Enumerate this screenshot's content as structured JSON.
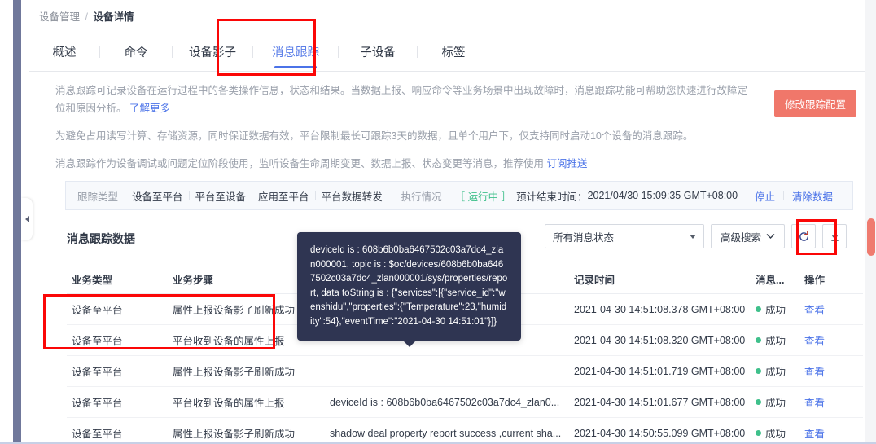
{
  "breadcrumb": {
    "parent": "设备管理",
    "separator": "/",
    "current": "设备详情"
  },
  "tabs": [
    {
      "label": "概述",
      "active": false
    },
    {
      "label": "命令",
      "active": false
    },
    {
      "label": "设备影子",
      "active": false
    },
    {
      "label": "消息跟踪",
      "active": true
    },
    {
      "label": "子设备",
      "active": false
    },
    {
      "label": "标签",
      "active": false
    }
  ],
  "description": {
    "line1_a": "消息跟踪可记录设备在运行过程中的各类操作信息，状态和结果。当数据上报、响应命令等业务场景中出现故障时，消息跟踪功能可帮助您快速进行故障定位和原因分析。",
    "line1_link": "了解更多",
    "line2": "为避免占用读写计算、存储资源，同时保证数据有效，平台限制最长可跟踪3天的数据，且单个用户下，仅支持同时启动10个设备的消息跟踪。",
    "line3_a": "消息跟踪作为设备调试或问题定位阶段使用，监听设备生命周期变更、数据上报、状态变更等消息，推荐使用",
    "line3_link": "订阅推送",
    "modify_button": "修改跟踪配置"
  },
  "track_bar": {
    "type_label": "跟踪类型",
    "types": [
      "设备至平台",
      "平台至设备",
      "应用至平台",
      "平台数据转发"
    ],
    "exec_label": "执行情况",
    "status": "［ 运行中 ］",
    "end_label": "预计结束时间：",
    "end_time": "2021/04/30 15:09:35 GMT+08:00",
    "stop_link": "停止",
    "clear_link": "清除数据"
  },
  "toolbar": {
    "section_title": "消息跟踪数据",
    "status_filter": "所有消息状态",
    "advanced_search": "高级搜索",
    "refresh_icon": "refresh-icon",
    "download_icon": "download-icon"
  },
  "table": {
    "headers": [
      "业务类型",
      "业务步骤",
      "",
      "记录时间",
      "消息...",
      "操作"
    ],
    "rows": [
      {
        "type": "设备至平台",
        "step": "属性上报设备影子刷新成功",
        "content": "",
        "time": "2021-04-30 14:51:08.378 GMT+08:00",
        "status": "成功",
        "action": "查看"
      },
      {
        "type": "设备至平台",
        "step": "平台收到设备的属性上报",
        "content": "",
        "time": "2021-04-30 14:51:08.320 GMT+08:00",
        "status": "成功",
        "action": "查看"
      },
      {
        "type": "设备至平台",
        "step": "属性上报设备影子刷新成功",
        "content": "",
        "time": "2021-04-30 14:51:01.719 GMT+08:00",
        "status": "成功",
        "action": "查看"
      },
      {
        "type": "设备至平台",
        "step": "平台收到设备的属性上报",
        "content": "deviceId is : 608b6b0ba6467502c03a7dc4_zlan0...",
        "time": "2021-04-30 14:51:01.677 GMT+08:00",
        "status": "成功",
        "action": "查看"
      },
      {
        "type": "设备至平台",
        "step": "属性上报设备影子刷新成功",
        "content": "shadow deal property report success ,current sha...",
        "time": "2021-04-30 14:50:55.099 GMT+08:00",
        "status": "成功",
        "action": "查看"
      }
    ]
  },
  "tooltip": {
    "text": "deviceId is : 608b6b0ba6467502c03a7dc4_zlan000001, topic is : $oc/devices/608b6b0ba6467502c03a7dc4_zlan000001/sys/properties/report, data toString is : {\"services\":[{\"service_id\":\"wenshidu\",\"properties\":{\"Temperature\":23,\"humidity\":54},\"eventTime\":\"2021-04-30 14:51:01\"}]}"
  },
  "colors": {
    "accent_blue": "#4b73e8",
    "status_green": "#3fc08b",
    "modify_button": "#f0776a",
    "annotation_red": "#fb0707",
    "tooltip_bg": "#2f3552",
    "scrollbar_thumb": "#ef7b6f"
  }
}
